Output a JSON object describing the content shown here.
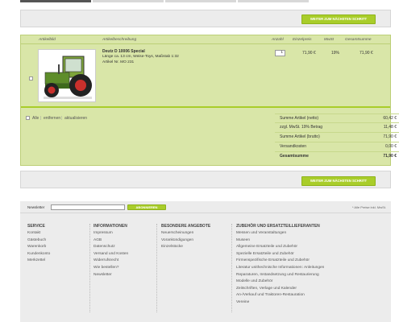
{
  "top_button": "WEITER ZUM NÄCHSTEN SCHRITT",
  "bottom_button": "WEITER ZUM NÄCHSTEN SCHRITT",
  "cart": {
    "headers": {
      "image": "Artikelbild",
      "desc": "Artikelbeschreibung",
      "qty": "Anzahl",
      "price": "Einzelpreis",
      "vat": "MwSt",
      "total": "Gesamtsumme"
    },
    "item": {
      "name": "Deutz D 10006 Special",
      "line2": "Länge ca. 13 cm, Weise-Toys, Maßstab 1:32",
      "line3": "Artikel Nr. MO 231",
      "qty": "1",
      "price": "71,90 €",
      "vat": "19%",
      "total": "71,90 €"
    },
    "actions": {
      "all": "Alle",
      "remove": "entfernen",
      "update": "aktualisieren"
    },
    "summary": [
      {
        "label": "Summe Artikel (netto)",
        "value": "60,42 €"
      },
      {
        "label": "zzgl. MwSt. 19% Betrag",
        "value": "11,48 €"
      },
      {
        "label": "Summe Artikel (brutto)",
        "value": "71,90 €"
      },
      {
        "label": "Versandkosten",
        "value": "0,00 €"
      },
      {
        "label": "Gesamtsumme",
        "value": "71,90 €"
      }
    ]
  },
  "newsletter": {
    "label": "Newsletter",
    "button": "ABONNIEREN",
    "note": "* Alle Preise inkl. MwSt."
  },
  "footer": {
    "service": {
      "title": "SERVICE",
      "items": [
        "Kontakt",
        "Gästebuch",
        "Warenkorb",
        "Kundenkonto",
        "Merkzettel"
      ]
    },
    "info": {
      "title": "INFORMATIONEN",
      "items": [
        "Impressum",
        "AGB",
        "Datenschutz",
        "Versand und Kosten",
        "Widerrufsrecht",
        "Wie bestellen?",
        "Newsletter"
      ]
    },
    "offers": {
      "title": "BESONDERE ANGEBOTE",
      "items": [
        "Neuerscheinungen",
        "Vorankündigungen",
        "Einzelstücke"
      ]
    },
    "parts": {
      "title": "ZUBEHÖR UND ERSATZTEILLIEFERANTEN",
      "items": [
        "Messen und Veranstaltungen",
        "Museen",
        "Allgemeine Ersatzteile und Zubehör",
        "Spezielle Ersatzteile und Zubehör",
        "Firmenspezifische Ersatzteile und Zubehör",
        "Literatur unithechnische Informationen: Anleitungen",
        "Reparaturen, Instandsetzung und Restaurierung",
        "Modelle und Zubehör",
        "Zeitschriften, Verlage und Kalender",
        "An-/Verkauf und Traktoren-Restauration",
        "Vereine"
      ]
    }
  }
}
